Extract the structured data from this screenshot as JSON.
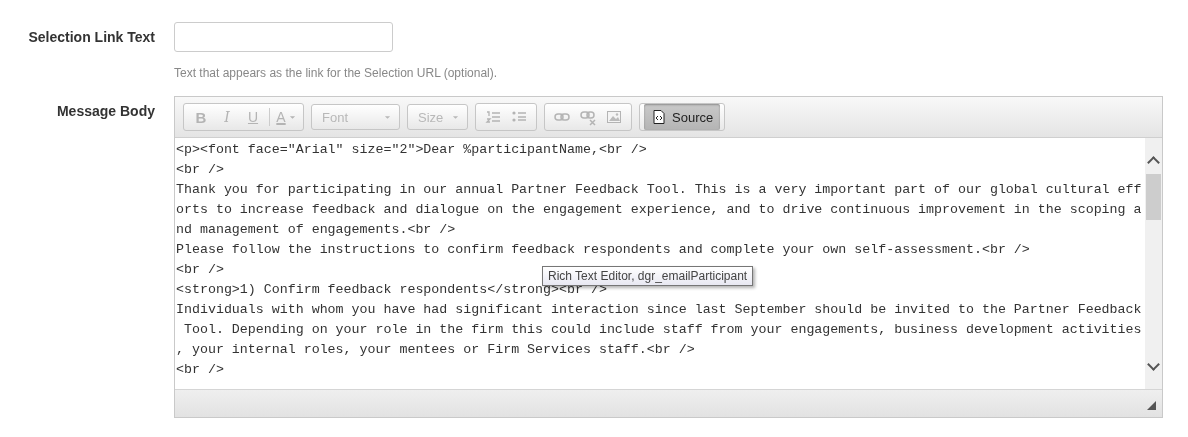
{
  "fields": [
    {
      "label": "Selection Link Text",
      "kind": "input",
      "hint": "Text that appears as the link for the Selection URL (optional)."
    },
    {
      "label": "Message Body",
      "kind": "editor"
    }
  ],
  "editor": {
    "toolbar": [
      {
        "buttons": [
          {
            "kind": "bold",
            "label": "B",
            "disabled": true
          },
          {
            "kind": "italic",
            "label": "I",
            "disabled": true
          },
          {
            "kind": "underline",
            "label": "U",
            "disabled": true
          },
          {
            "kind": "color",
            "label": "A",
            "disabled": true
          }
        ]
      },
      {
        "combo": {
          "placeholder": "Font",
          "disabled": true
        }
      },
      {
        "combo": {
          "placeholder": "Size",
          "disabled": true
        }
      },
      {
        "buttons": [
          {
            "kind": "numbered-list",
            "disabled": true
          },
          {
            "kind": "bullet-list",
            "disabled": true
          }
        ]
      },
      {
        "buttons": [
          {
            "kind": "link",
            "disabled": true
          },
          {
            "kind": "unlink",
            "disabled": true
          },
          {
            "kind": "image",
            "disabled": true
          }
        ]
      },
      {
        "buttons": [
          {
            "kind": "source",
            "label": "Source",
            "disabled": false,
            "on": true
          }
        ]
      }
    ],
    "lines": [
      "<p><font face=\"Arial\" size=\"2\">Dear %participantName,<br />",
      "<br />",
      "Thank you for participating in our annual Partner Feedback Tool. This is a very important part of our global cultural eff",
      "orts to increase feedback and dialogue on the engagement experience, and to drive continuous improvement in the scoping a",
      "nd management of engagements.<br />",
      "Please follow the instructions to confirm feedback respondents and complete your own self-assessment.<br />",
      "<br />",
      "<strong>1) Confirm feedback respondents</strong><br />",
      "Individuals with whom you have had significant interaction since last September should be invited to the Partner Feedback",
      " Tool. Depending on your role in the firm this could include staff from your engagements, business development activities",
      ", your internal roles, your mentees or Firm Services staff.<br />",
      "<br />"
    ],
    "tooltip": "Rich Text Editor, dgr_emailParticipant"
  }
}
